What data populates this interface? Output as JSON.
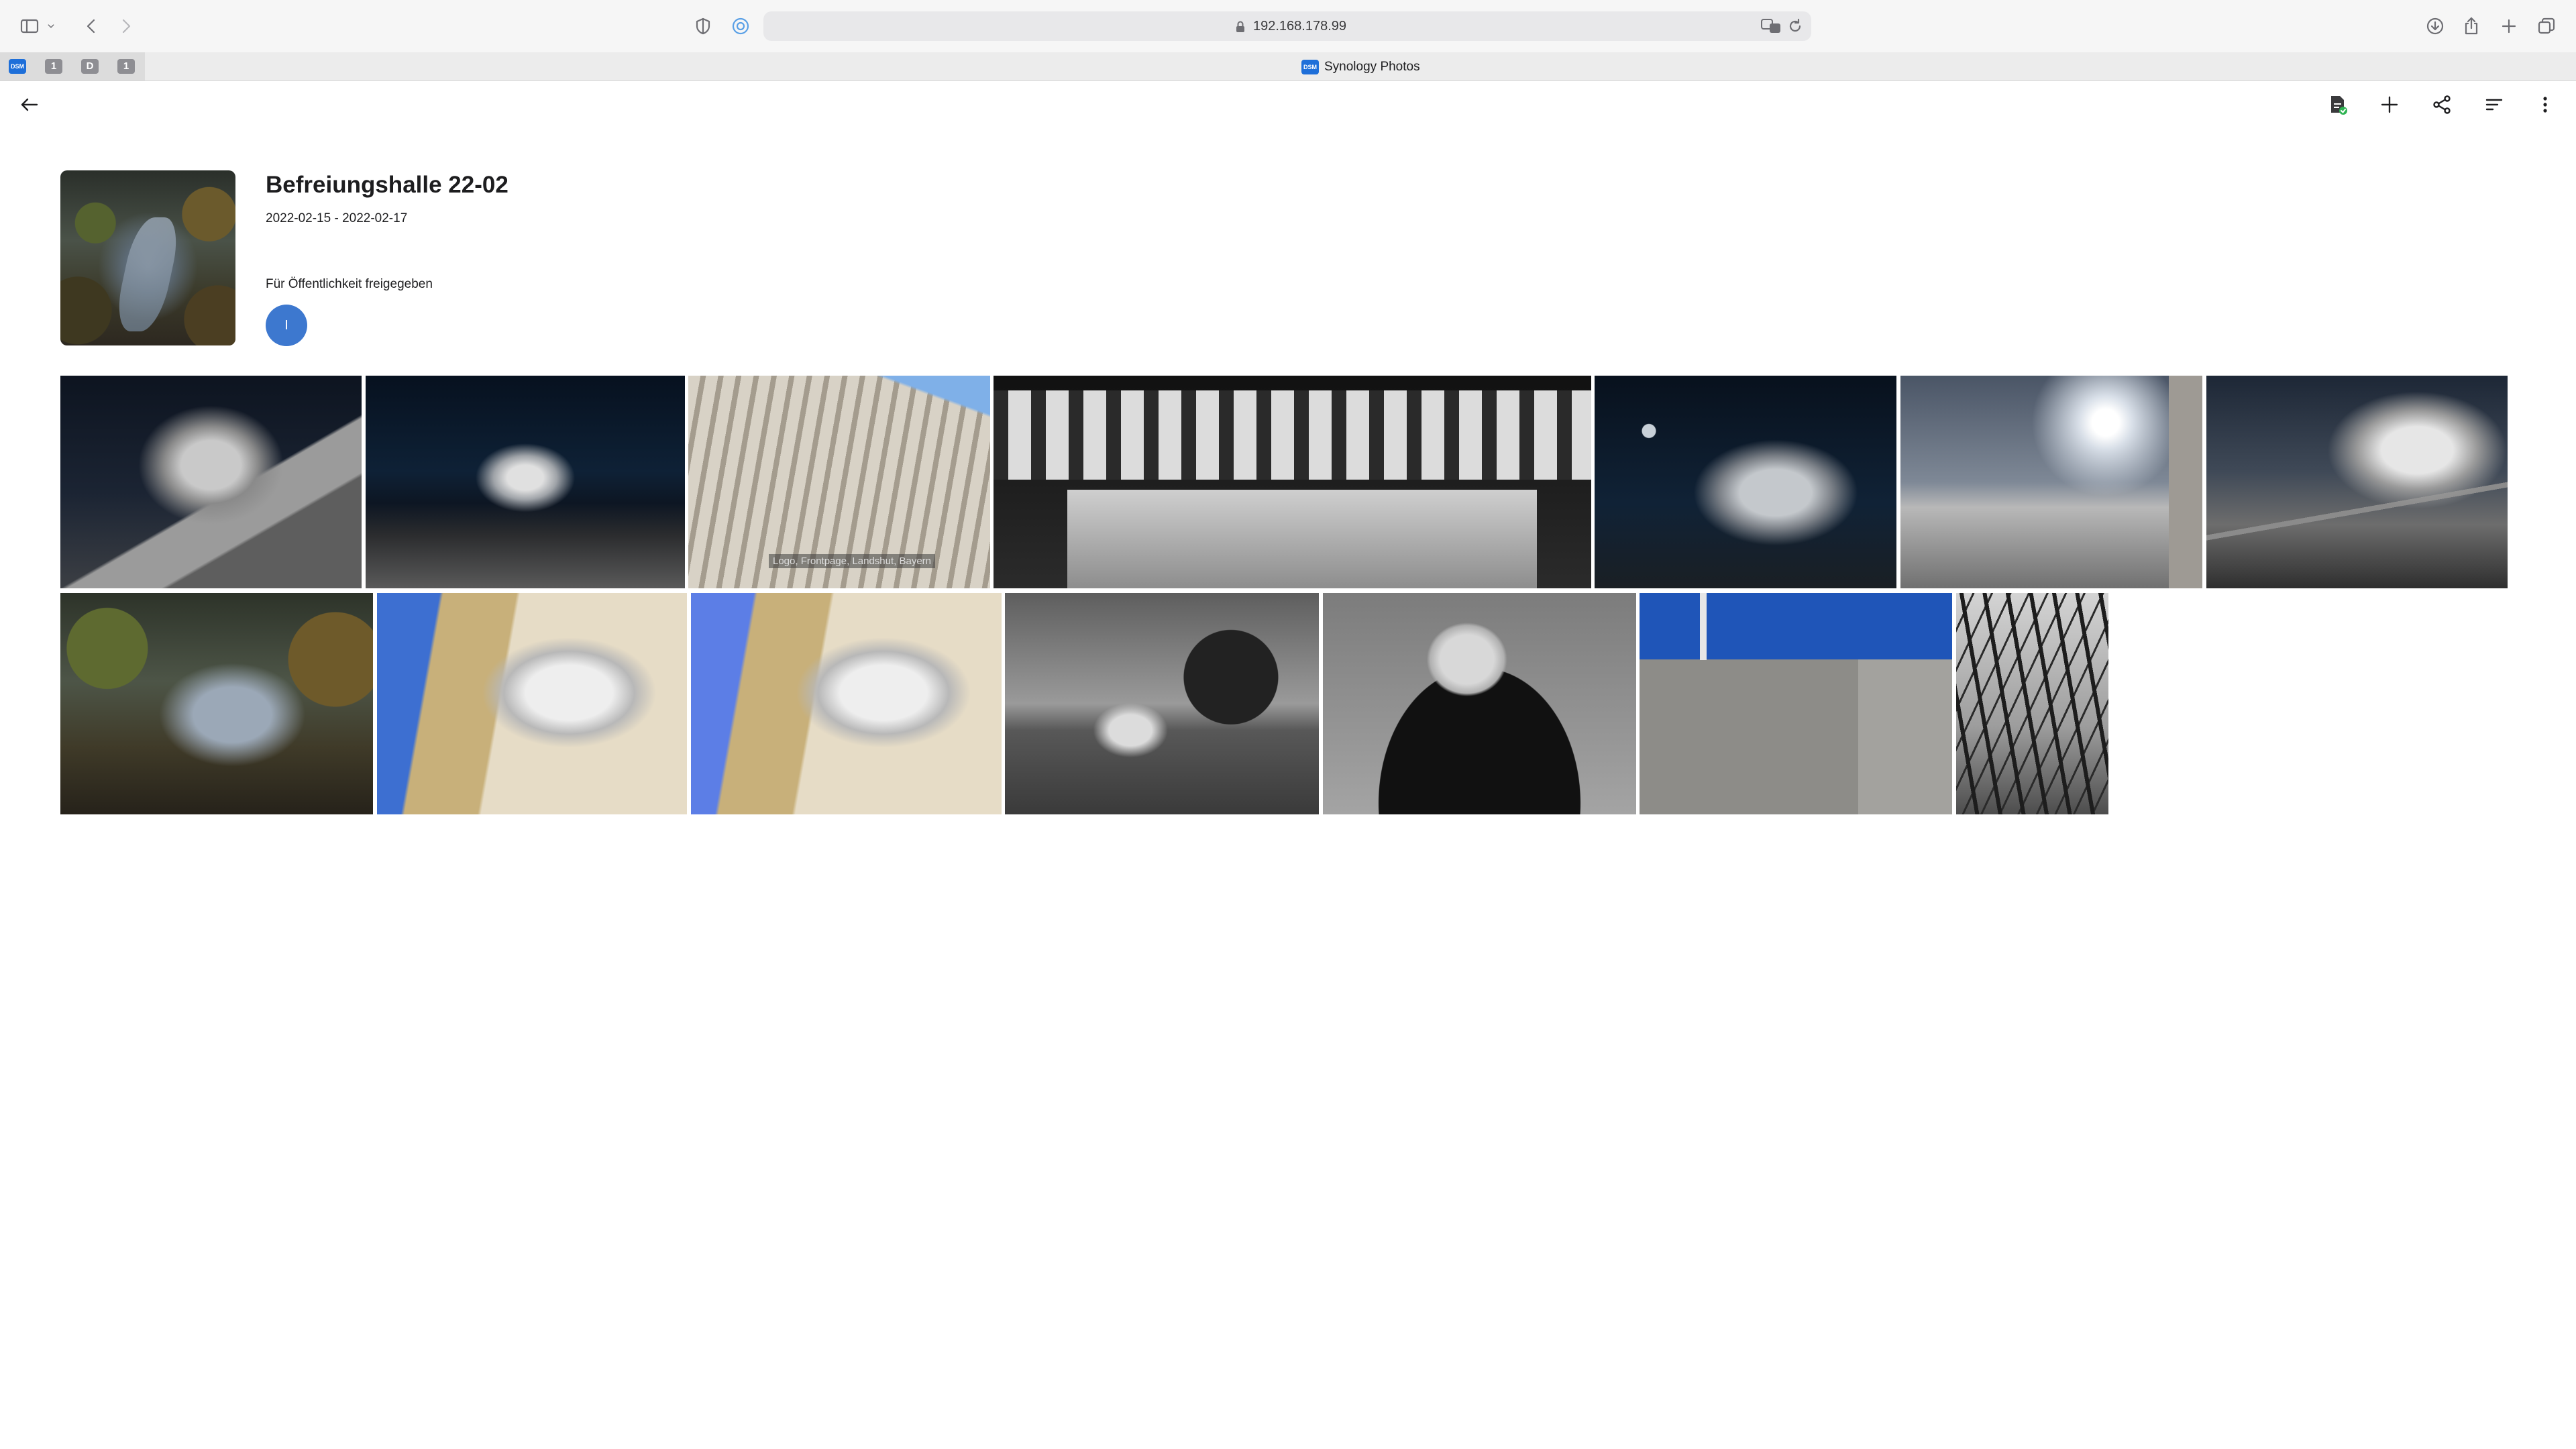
{
  "browser": {
    "url": "192.168.178.99",
    "pinned_tabs": [
      {
        "label": "DSM",
        "kind": "dsm"
      },
      {
        "label": "1",
        "kind": "num"
      },
      {
        "label": "D",
        "kind": "num"
      },
      {
        "label": "1",
        "kind": "num"
      }
    ],
    "active_tab": {
      "icon_label": "DSM",
      "title": "Synology Photos"
    }
  },
  "app_header": {
    "icons": [
      "back-arrow-icon",
      "photo-upload-status-icon",
      "add-icon",
      "share-icon",
      "sort-icon",
      "more-icon"
    ],
    "upload_status_color": "#2eb352"
  },
  "album": {
    "title": "Befreiungshalle 22-02",
    "dates": "2022-02-15 - 2022-02-17",
    "share_label": "Für Öffentlichkeit freigegeben",
    "avatar_initial": "I",
    "avatar_color": "#3d78cf"
  },
  "photos": [
    {
      "name": "photo-befreiungshalle-dark-1"
    },
    {
      "name": "photo-befreiungshalle-night-wide"
    },
    {
      "name": "photo-facade-detail",
      "caption": "Logo, Frontpage, Landshut, Bayern"
    },
    {
      "name": "photo-colonnade-statues"
    },
    {
      "name": "photo-befreiungshalle-moon"
    },
    {
      "name": "photo-sun-column-path"
    },
    {
      "name": "photo-befreiungshalle-stairs"
    },
    {
      "name": "photo-danube-valley"
    },
    {
      "name": "photo-statues-blue-sky-1"
    },
    {
      "name": "photo-statues-blue-sky-2"
    },
    {
      "name": "photo-tree-monochrome"
    },
    {
      "name": "photo-portrait-sunglasses"
    },
    {
      "name": "photo-concrete-wall-blue-sky"
    },
    {
      "name": "photo-bare-trees"
    }
  ]
}
